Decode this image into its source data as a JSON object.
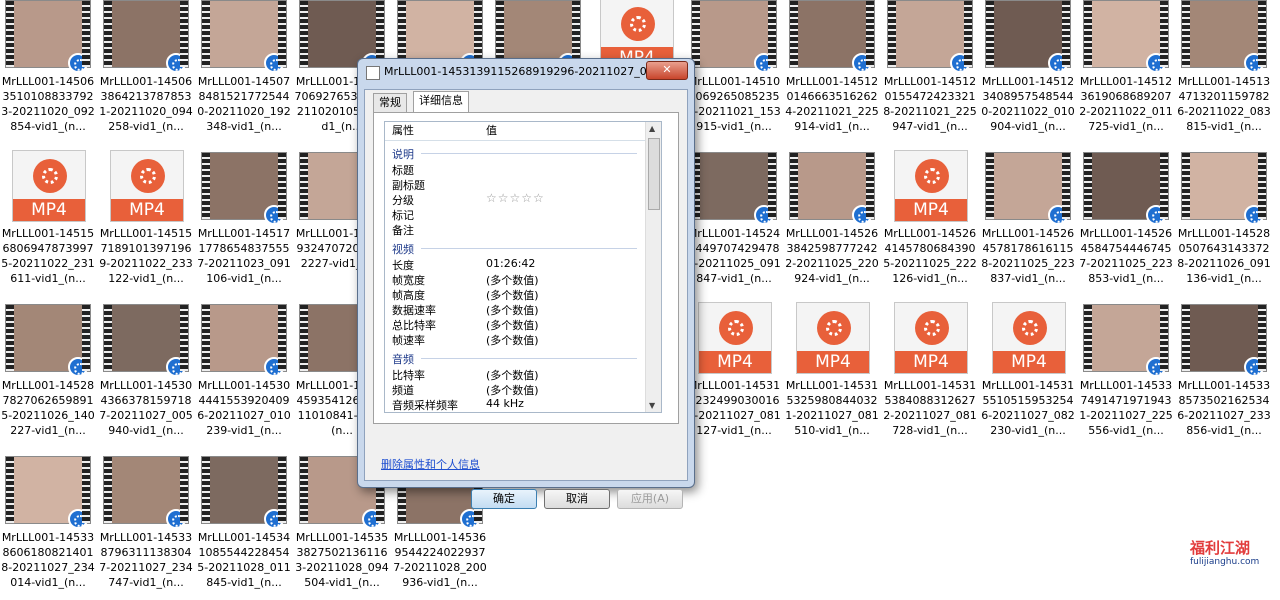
{
  "files": [
    {
      "name": "MrLLL001-1450635101088337923-20211020_092854-vid1_(n...",
      "kind": "video"
    },
    {
      "name": "MrLLL001-1450638642137878531-20211020_094258-vid1_(n...",
      "kind": "video"
    },
    {
      "name": "MrLLL001-1450784815217725440-20211020_192348-vid1_(n...",
      "kind": "video"
    },
    {
      "name": "MrLLL001-1450870692765371-2021102010503-vid1_(n...",
      "kind": "video"
    },
    {
      "name": "",
      "kind": "video"
    },
    {
      "name": "",
      "kind": "video"
    },
    {
      "name": "",
      "kind": "mp4"
    },
    {
      "name": "MrLLL001-1451090692650852359-20211021_153915-vid1_(n...",
      "kind": "video"
    },
    {
      "name": "MrLLL001-1451201466635162624-20211021_225914-vid1_(n...",
      "kind": "video"
    },
    {
      "name": "MrLLL001-1451201554724233218-20211021_225947-vid1_(n...",
      "kind": "video"
    },
    {
      "name": "MrLLL001-1451234089575485440-20211022_010904-vid1_(n...",
      "kind": "video"
    },
    {
      "name": "MrLLL001-1451236190686892072-20211022_011725-vid1_(n...",
      "kind": "video"
    },
    {
      "name": "MrLLL001-1451347132011597826-20211022_083815-vid1_(n...",
      "kind": "video"
    },
    {
      "name": "MrLLL001-1451568069478739975-20211022_231611-vid1_(n...",
      "kind": "mp4"
    },
    {
      "name": "MrLLL001-1451571891013971969-20211022_233122-vid1_(n...",
      "kind": "mp4"
    },
    {
      "name": "MrLLL001-1451717786548375557-20211023_091106-vid1_(n...",
      "kind": "video"
    },
    {
      "name": "MrLLL001-1452793247072021022227-vid1_(n...",
      "kind": "video"
    },
    {
      "name": "",
      "kind": "video"
    },
    {
      "name": "",
      "kind": "video"
    },
    {
      "name": "",
      "kind": "video"
    },
    {
      "name": "MrLLL001-1452444497074294784-20211025_091847-vid1_(n...",
      "kind": "video"
    },
    {
      "name": "MrLLL001-1452638425987772422-20211025_220924-vid1_(n...",
      "kind": "video"
    },
    {
      "name": "MrLLL001-1452641457806843905-20211025_222126-vid1_(n...",
      "kind": "mp4"
    },
    {
      "name": "MrLLL001-1452645781786161158-20211025_223837-vid1_(n...",
      "kind": "video"
    },
    {
      "name": "MrLLL001-1452645847544467457-20211025_223853-vid1_(n...",
      "kind": "video"
    },
    {
      "name": "MrLLL001-1452805076431433728-20211026_091136-vid1_(n...",
      "kind": "video"
    },
    {
      "name": "MrLLL001-1452878270626598915-20211026_140227-vid1_(n...",
      "kind": "video"
    },
    {
      "name": "MrLLL001-1453043663781597187-20211027_005940-vid1_(n...",
      "kind": "video"
    },
    {
      "name": "MrLLL001-1453044415539204096-20211027_010239-vid1_(n...",
      "kind": "video"
    },
    {
      "name": "MrLLL001-14530459354126120211010841-vid1_(n...",
      "kind": "video"
    },
    {
      "name": "",
      "kind": "video"
    },
    {
      "name": "",
      "kind": "video"
    },
    {
      "name": "",
      "kind": "video"
    },
    {
      "name": "MrLLL001-1453152324990300160-20211027_081127-vid1_(n...",
      "kind": "mp4"
    },
    {
      "name": "MrLLL001-1453153259808440321-20211027_081510-vid1_(n...",
      "kind": "mp4"
    },
    {
      "name": "MrLLL001-1453153840883126272-20211027_081728-vid1_(n...",
      "kind": "mp4"
    },
    {
      "name": "MrLLL001-1453155105159532546-20211027_082230-vid1_(n...",
      "kind": "mp4"
    },
    {
      "name": "MrLLL001-1453374914719719431-20211027_225556-vid1_(n...",
      "kind": "video"
    },
    {
      "name": "MrLLL001-1453385735021625346-20211027_233856-vid1_(n...",
      "kind": "video"
    },
    {
      "name": "MrLLL001-1453386061808214018-20211027_234014-vid1_(n...",
      "kind": "video"
    },
    {
      "name": "MrLLL001-1453387963111383047-20211027_234747-vid1_(n...",
      "kind": "video"
    },
    {
      "name": "MrLLL001-1453410855442284545-20211028_011845-vid1_(n...",
      "kind": "video"
    },
    {
      "name": "MrLLL001-1453538275021361163-20211028_094504-vid1_(n...",
      "kind": "video"
    },
    {
      "name": "MrLLL001-1453695442240229377-20211028_200936-vid1_(n...",
      "kind": "video"
    }
  ],
  "dialog": {
    "title": "MrLLL001-1453139115268919296-20211027_07...",
    "close": "✕",
    "tabs": [
      "常规",
      "详细信息"
    ],
    "header": {
      "prop": "属性",
      "value": "值"
    },
    "groups": {
      "description": "说明",
      "video": "视频",
      "audio": "音频"
    },
    "desc_rows": [
      "标题",
      "副标题",
      "分级",
      "标记",
      "备注"
    ],
    "stars": "☆☆☆☆☆",
    "video_rows": [
      {
        "label": "长度",
        "value": "01:26:42"
      },
      {
        "label": "帧宽度",
        "value": "(多个数值)"
      },
      {
        "label": "帧高度",
        "value": "(多个数值)"
      },
      {
        "label": "数据速率",
        "value": "(多个数值)"
      },
      {
        "label": "总比特率",
        "value": "(多个数值)"
      },
      {
        "label": "帧速率",
        "value": "(多个数值)"
      }
    ],
    "audio_rows": [
      {
        "label": "比特率",
        "value": "(多个数值)"
      },
      {
        "label": "频道",
        "value": "(多个数值)"
      },
      {
        "label": "音频采样频率",
        "value": "44 kHz"
      }
    ],
    "remove_link": "删除属性和个人信息",
    "buttons": {
      "ok": "确定",
      "cancel": "取消",
      "apply": "应用(A)"
    }
  },
  "watermark": {
    "title": "福利江湖",
    "url": "fulijianghu.com"
  },
  "mp4_label": "MP4"
}
